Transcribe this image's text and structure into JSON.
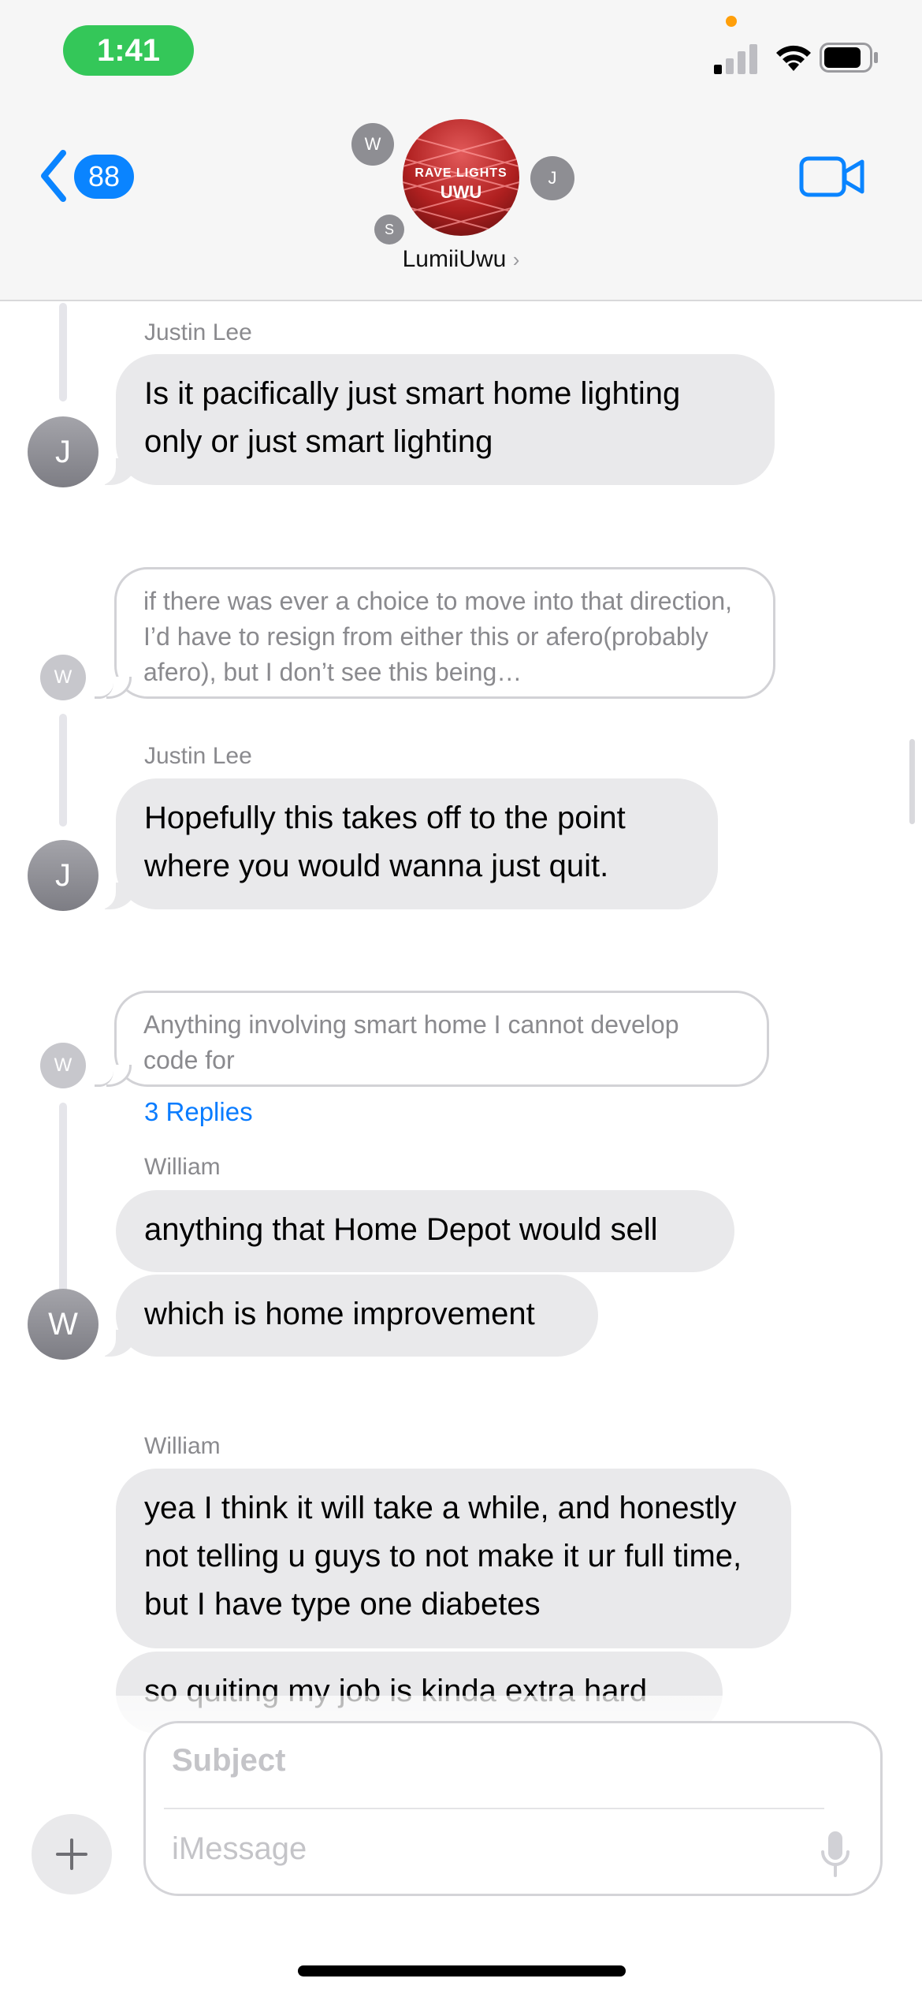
{
  "status_bar": {
    "time": "1:41"
  },
  "nav": {
    "back_count": "88",
    "group_name": "LumiiUwu",
    "chevron": "›"
  },
  "avatars": {
    "group_text_line1": "RAVE LIGHTS",
    "group_text_line2": "UWU",
    "mini_w": "W",
    "mini_j": "J",
    "mini_s": "S"
  },
  "messages": [
    {
      "sender": "Justin Lee",
      "text": "Is it pacifically just smart home lighting only or just smart lighting",
      "avatar": "J"
    },
    {
      "quote": "if there was ever a choice to move into that direction, I’d have to resign from either this or afero(probably afero), but I don’t see this being…",
      "avatar": "W"
    },
    {
      "sender": "Justin Lee",
      "text": "Hopefully this takes off to the point where you would wanna just quit.",
      "avatar": "J"
    },
    {
      "quote": "Anything involving smart home I cannot develop code for",
      "avatar": "W"
    },
    {
      "replies": "3 Replies"
    },
    {
      "sender": "William",
      "texts": [
        "anything that Home Depot would sell",
        "which is home improvement"
      ],
      "avatar": "W"
    },
    {
      "sender": "William",
      "texts": [
        "yea I think it will take a while, and honestly not telling u guys to not make it ur full time, but I have type one diabetes",
        "so quiting my job is kinda extra hard"
      ]
    }
  ],
  "compose": {
    "subject_placeholder": "Subject",
    "message_placeholder": "iMessage"
  },
  "icons": [
    "chevron-left-icon",
    "video-camera-icon",
    "cellular-signal-icon",
    "wifi-icon",
    "battery-icon",
    "plus-icon",
    "microphone-icon"
  ],
  "colors": {
    "accent": "#0a84ff",
    "bubble": "#e9e9eb",
    "time_pill": "#34c759"
  }
}
